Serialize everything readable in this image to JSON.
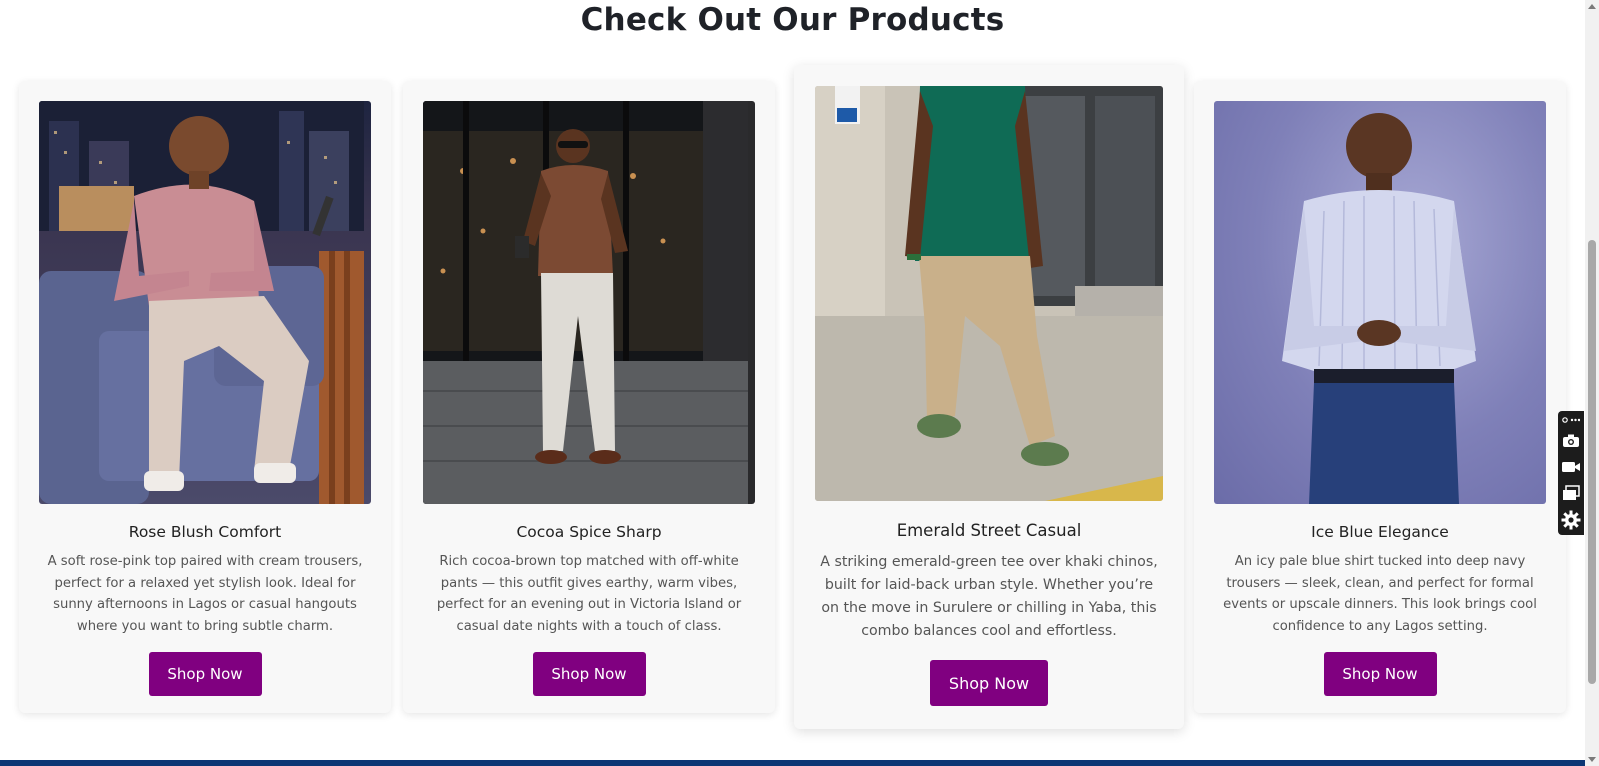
{
  "section": {
    "title": "Check Out Our Products"
  },
  "products": [
    {
      "title": "Rose Blush Comfort",
      "description": "A soft rose-pink top paired with cream trousers, perfect for a relaxed yet stylish look. Ideal for sunny afternoons in Lagos or casual hangouts where you want to bring subtle charm.",
      "button_label": "Shop Now",
      "photo": "man-in-rose-pink-sweater-seated-on-talk-show-couch"
    },
    {
      "title": "Cocoa Spice Sharp",
      "description": "Rich cocoa-brown top matched with off-white pants — this outfit gives earthy, warm vibes, perfect for an evening out in Victoria Island or casual date nights with a touch of class.",
      "button_label": "Shop Now",
      "photo": "man-in-brown-henley-and-white-pants-on-street"
    },
    {
      "title": "Emerald Street Casual",
      "description": "A striking emerald-green tee over khaki chinos, built for laid-back urban style. Whether you’re on the move in Surulere or chilling in Yaba, this combo balances cool and effortless.",
      "button_label": "Shop Now",
      "photo": "man-in-green-tee-and-khaki-chinos-walking"
    },
    {
      "title": "Ice Blue Elegance",
      "description": "An icy pale blue shirt tucked into deep navy trousers — sleek, clean, and perfect for formal events or upscale dinners. This look brings cool confidence to any Lagos setting.",
      "button_label": "Shop Now",
      "photo": "man-in-pale-blue-shirt-and-navy-trousers"
    }
  ],
  "tool_panel": {
    "icons": [
      "link-more-icon",
      "camera-icon",
      "video-icon",
      "window-stack-icon",
      "gear-icon"
    ]
  },
  "colors": {
    "button": "#800080",
    "title": "#1f2228",
    "footer_bar": "#0c3674",
    "card_bg": "#f8f8f8"
  }
}
